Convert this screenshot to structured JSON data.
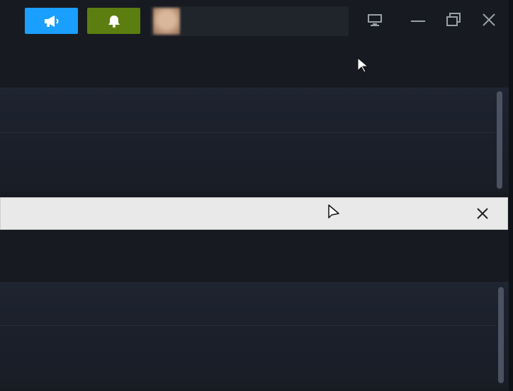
{
  "windows": [
    {
      "title_bar": {
        "buttons": [
          {
            "name": "announcements",
            "icon": "megaphone-icon",
            "color": "#1a9fff"
          },
          {
            "name": "notifications",
            "icon": "bell-icon",
            "color": "#5c7e10"
          }
        ],
        "account": {
          "name": "",
          "avatar": "avatar"
        },
        "window_controls": [
          "big-picture-icon",
          "minimize-icon",
          "restore-icon",
          "close-icon"
        ]
      }
    },
    {
      "popup_bar": {
        "close_icon": "close-icon",
        "background": "#e9e9e9"
      }
    }
  ],
  "colors": {
    "background": "#171a21",
    "content": "#1e2430",
    "accent_blue": "#1a9fff",
    "accent_green": "#5c7e10"
  }
}
